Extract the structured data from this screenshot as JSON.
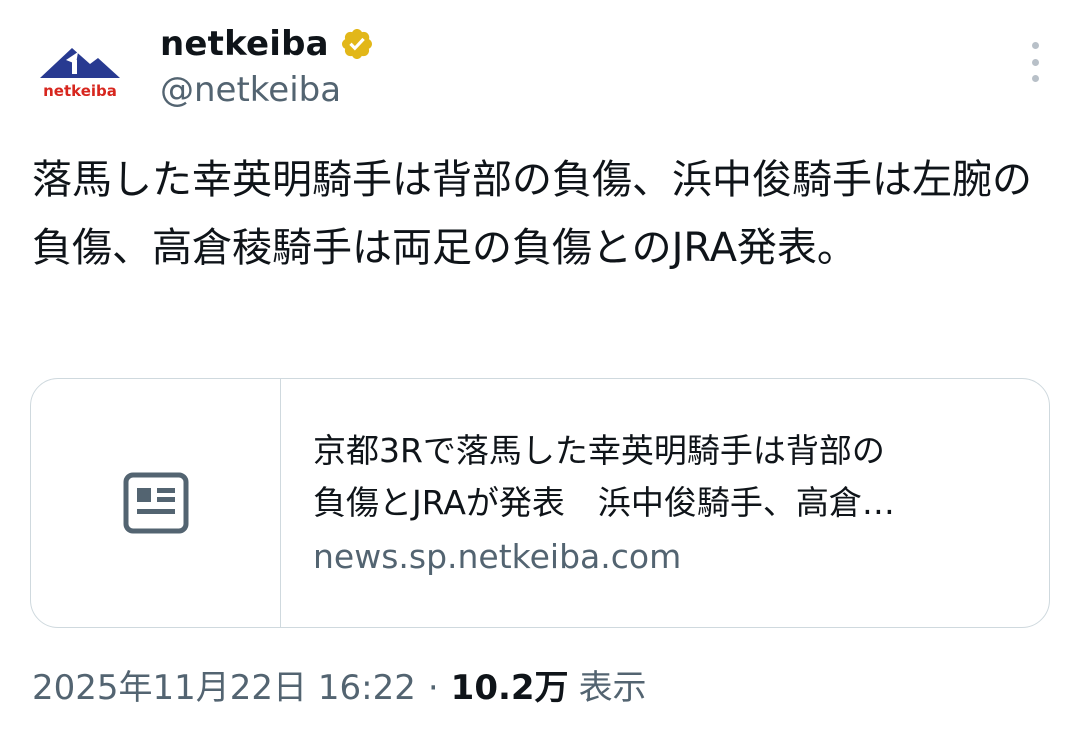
{
  "account": {
    "display_name": "netkeiba",
    "handle": "@netkeiba",
    "avatar_text": "netkeiba",
    "verified_icon": "verified-gold-badge-icon",
    "brand_colors": {
      "navy": "#283a91",
      "red": "#d7261e",
      "gold": "#e2b719"
    }
  },
  "tweet": {
    "text": "落馬した幸英明騎手は背部の負傷、浜中俊騎手は左腕の負傷、高倉稜騎手は両足の負傷とのJRA発表。"
  },
  "card": {
    "thumbnail_icon": "article-icon",
    "title_line1": "京都3Rで落馬した幸英明騎手は背部の",
    "title_line2": "負傷とJRAが発表　浜中俊騎手、高倉…",
    "domain": "news.sp.netkeiba.com"
  },
  "meta": {
    "timestamp": "2025年11月22日 16:22",
    "separator": "·",
    "views": "10.2万",
    "views_label": "表示"
  },
  "icons": {
    "more": "more-vertical-icon"
  }
}
